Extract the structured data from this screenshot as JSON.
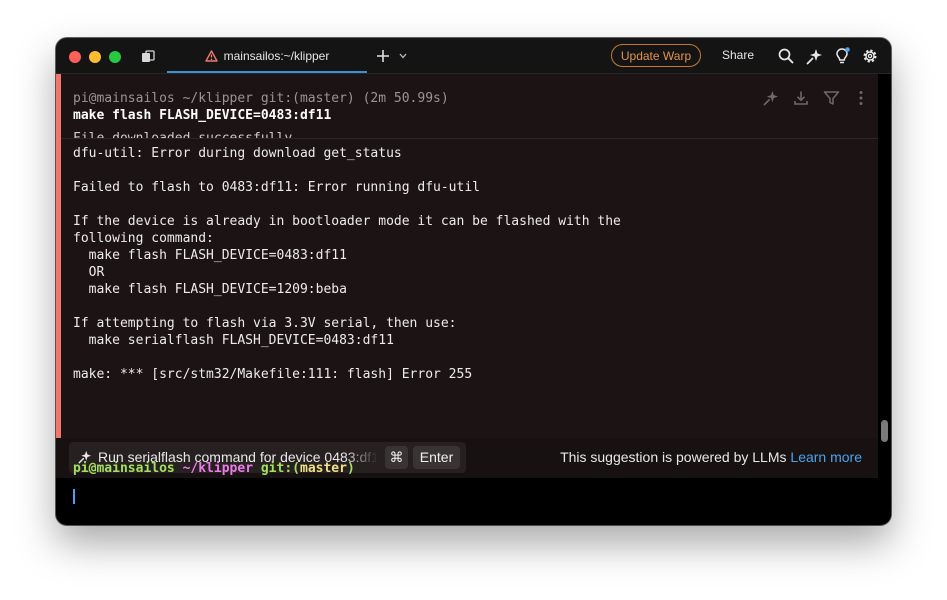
{
  "titlebar": {
    "tab_title": "mainsailos:~/klipper",
    "update_button": "Update Warp",
    "share_label": "Share"
  },
  "icons": {
    "tab_warning": "warning-triangle-icon",
    "new_tab": "plus-icon",
    "new_tab_menu": "chevron-down-icon",
    "search": "search-icon",
    "ai": "sparkle-icon",
    "resources": "lightbulb-icon",
    "settings": "gear-icon"
  },
  "block": {
    "prompt_meta": "pi@mainsailos ~/klipper git:(master) (2m 50.99s)",
    "command": "make flash FLASH_DEVICE=0483:df11",
    "partial_line": "File downloaded successfully",
    "output": "dfu-util: Error during download get_status\n\nFailed to flash to 0483:df11: Error running dfu-util\n\nIf the device is already in bootloader mode it can be flashed with the\nfollowing command:\n  make flash FLASH_DEVICE=0483:df11\n  OR\n  make flash FLASH_DEVICE=1209:beba\n\nIf attempting to flash via 3.3V serial, then use:\n  make serialflash FLASH_DEVICE=0483:df11\n\nmake: *** [src/stm32/Makefile:111: flash] Error 255"
  },
  "suggestion": {
    "text": "Run serialflash command for device 0483:df11",
    "key_cmd": "⌘",
    "key_enter": "Enter",
    "powered_text": "This suggestion is powered by LLMs",
    "learn_more": "Learn more"
  },
  "prompt": {
    "user": "pi@mainsailos",
    "dir": "~/klipper",
    "git": "git:(",
    "branch": "master",
    "git_close": ")"
  },
  "colors": {
    "error_bar": "#f0776b",
    "accent": "#4aa3f0",
    "update_border": "#c77a2a"
  }
}
